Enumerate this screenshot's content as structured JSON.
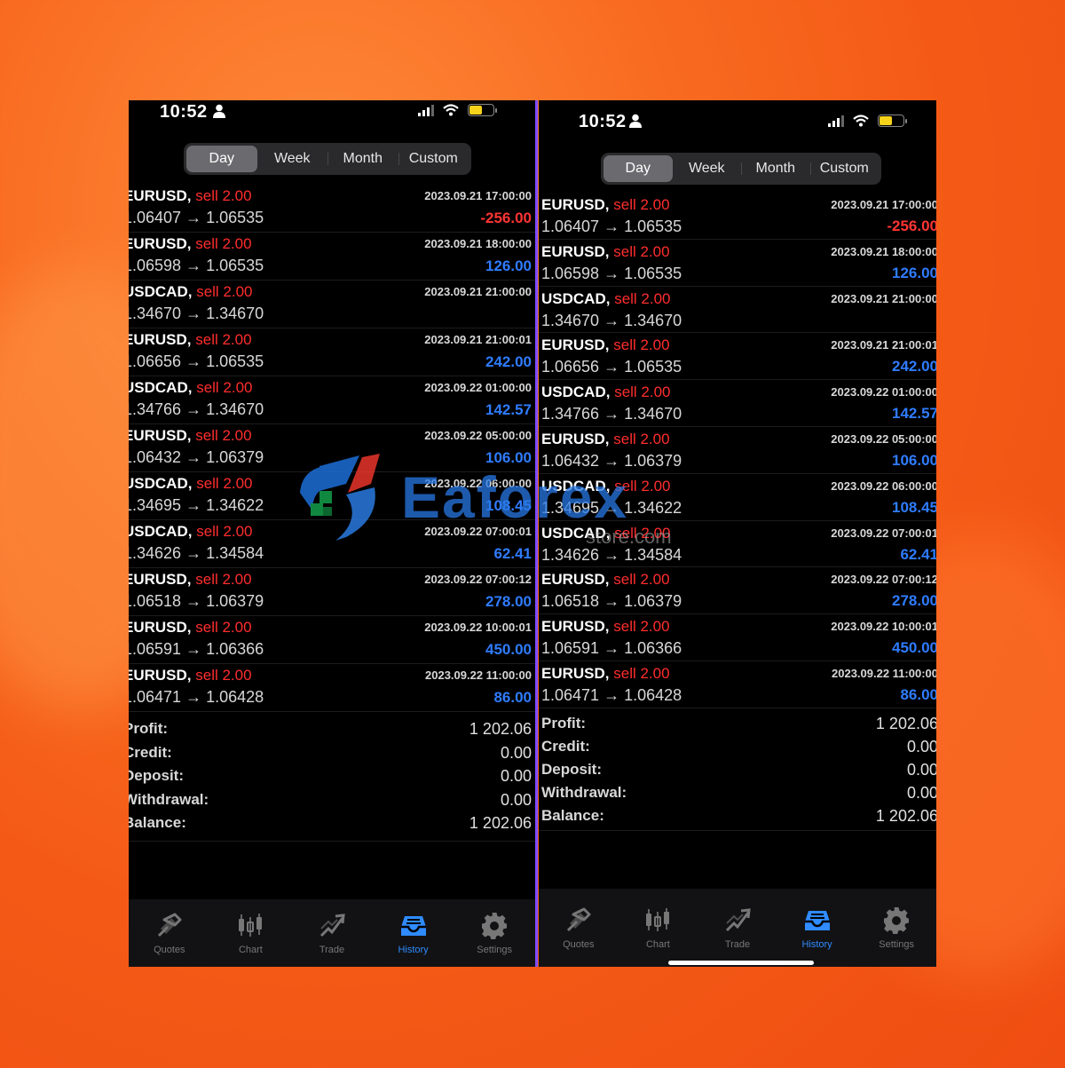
{
  "status": {
    "time": "10:52"
  },
  "segments": [
    "Day",
    "Week",
    "Month",
    "Custom"
  ],
  "active_segment": "Day",
  "trades": [
    {
      "symbol": "EURUSD,",
      "side": "sell 2.00",
      "prices": "1.06407 → 1.06535",
      "time": "2023.09.21 17:00:00",
      "profit": "-256.00",
      "sign": "neg"
    },
    {
      "symbol": "EURUSD,",
      "side": "sell 2.00",
      "prices": "1.06598 → 1.06535",
      "time": "2023.09.21 18:00:00",
      "profit": "126.00",
      "sign": "pos"
    },
    {
      "symbol": "USDCAD,",
      "side": "sell 2.00",
      "prices": "1.34670 → 1.34670",
      "time": "2023.09.21 21:00:00",
      "profit": "",
      "sign": "pos"
    },
    {
      "symbol": "EURUSD,",
      "side": "sell 2.00",
      "prices": "1.06656 → 1.06535",
      "time": "2023.09.21 21:00:01",
      "profit": "242.00",
      "sign": "pos"
    },
    {
      "symbol": "USDCAD,",
      "side": "sell 2.00",
      "prices": "1.34766 → 1.34670",
      "time": "2023.09.22 01:00:00",
      "profit": "142.57",
      "sign": "pos"
    },
    {
      "symbol": "EURUSD,",
      "side": "sell 2.00",
      "prices": "1.06432 → 1.06379",
      "time": "2023.09.22 05:00:00",
      "profit": "106.00",
      "sign": "pos"
    },
    {
      "symbol": "USDCAD,",
      "side": "sell 2.00",
      "prices": "1.34695 → 1.34622",
      "time": "2023.09.22 06:00:00",
      "profit": "108.45",
      "sign": "pos"
    },
    {
      "symbol": "USDCAD,",
      "side": "sell 2.00",
      "prices": "1.34626 → 1.34584",
      "time": "2023.09.22 07:00:01",
      "profit": "62.41",
      "sign": "pos"
    },
    {
      "symbol": "EURUSD,",
      "side": "sell 2.00",
      "prices": "1.06518 → 1.06379",
      "time": "2023.09.22 07:00:12",
      "profit": "278.00",
      "sign": "pos"
    },
    {
      "symbol": "EURUSD,",
      "side": "sell 2.00",
      "prices": "1.06591 → 1.06366",
      "time": "2023.09.22 10:00:01",
      "profit": "450.00",
      "sign": "pos"
    },
    {
      "symbol": "EURUSD,",
      "side": "sell 2.00",
      "prices": "1.06471 → 1.06428",
      "time": "2023.09.22 11:00:00",
      "profit": "86.00",
      "sign": "pos"
    }
  ],
  "summary": [
    {
      "label": "Profit:",
      "value": "1 202.06"
    },
    {
      "label": "Credit:",
      "value": "0.00"
    },
    {
      "label": "Deposit:",
      "value": "0.00"
    },
    {
      "label": "Withdrawal:",
      "value": "0.00"
    },
    {
      "label": "Balance:",
      "value": "1 202.06"
    }
  ],
  "tabs": [
    {
      "label": "Quotes",
      "icon": "quotes-icon"
    },
    {
      "label": "Chart",
      "icon": "candlestick-chart-icon"
    },
    {
      "label": "Trade",
      "icon": "trade-icon"
    },
    {
      "label": "History",
      "icon": "history-inbox-icon",
      "active": true
    },
    {
      "label": "Settings",
      "icon": "gear-icon"
    }
  ],
  "watermark": {
    "brand": "Eaforex",
    "sub": "store.com"
  },
  "colors": {
    "sell": "#ff2d2d",
    "loss": "#ff3434",
    "gain": "#2f7cff",
    "active_tab": "#2f8bff",
    "divider": "#7d4cff"
  }
}
